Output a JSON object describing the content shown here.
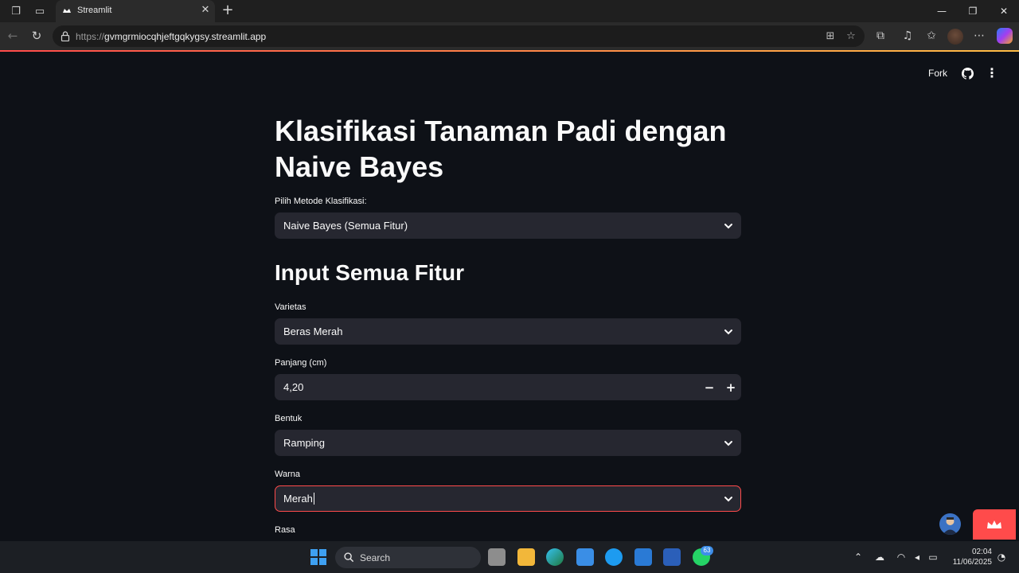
{
  "browser": {
    "tab_title": "Streamlit",
    "url_prefix": "https://",
    "url_host": "gvmgrmiocqhjeftgqkygsy.streamlit.app"
  },
  "app_header": {
    "fork_label": "Fork"
  },
  "page": {
    "title": "Klasifikasi Tanaman Padi dengan Naive Bayes",
    "method_label": "Pilih Metode Klasifikasi:",
    "method_value": "Naive Bayes (Semua Fitur)",
    "section_title": "Input Semua Fitur",
    "fields": [
      {
        "label": "Varietas",
        "value": "Beras Merah"
      },
      {
        "label": "Panjang (cm)",
        "value": "4,20"
      },
      {
        "label": "Bentuk",
        "value": "Ramping"
      },
      {
        "label": "Warna",
        "value": "Merah"
      },
      {
        "label": "Rasa"
      }
    ],
    "stepper_minus": "−",
    "stepper_plus": "+"
  },
  "taskbar": {
    "search_placeholder": "Search",
    "whatsapp_badge": "63",
    "time": "02:04",
    "date": "11/06/2025"
  },
  "colors": {
    "app_bg": "#0e1117",
    "input_bg": "#262730",
    "accent": "#ff4b4b",
    "text": "#fafafa"
  }
}
